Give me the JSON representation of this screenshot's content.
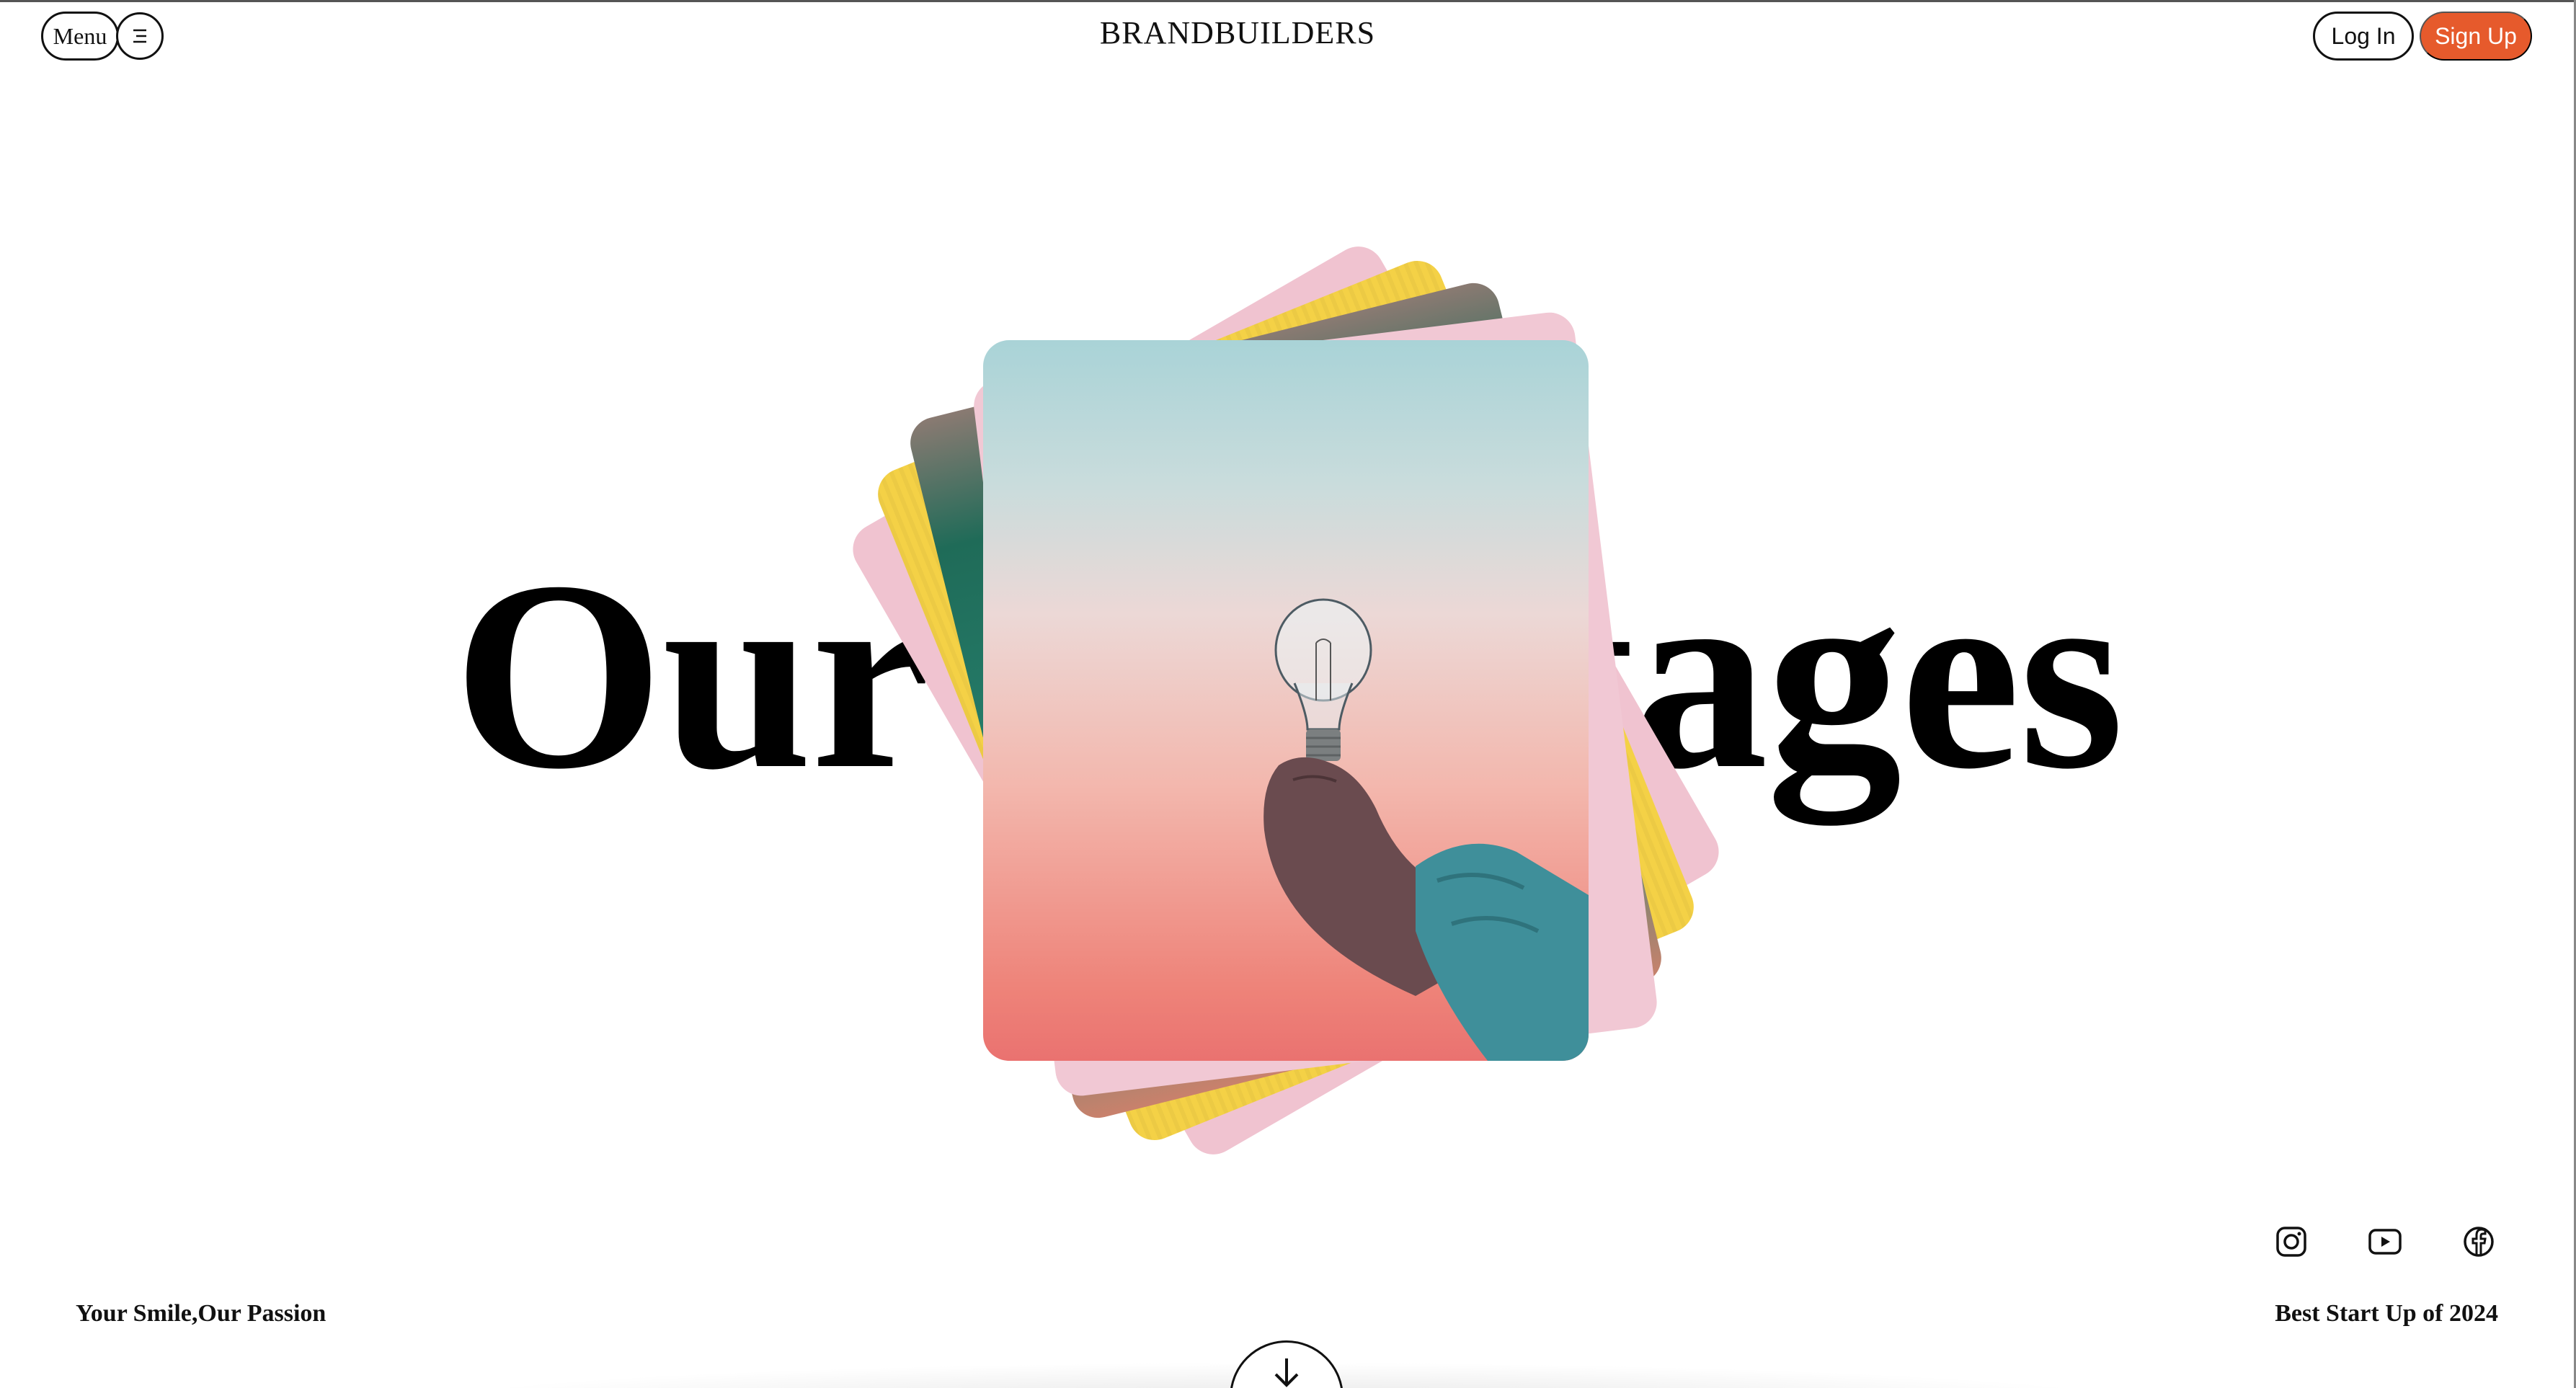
{
  "header": {
    "menu_label": "Menu",
    "brand": "BRANDBUILDERS",
    "login_label": "Log In",
    "signup_label": "Sign Up"
  },
  "hero": {
    "title_part1": "Our A",
    "title_part2": "tages",
    "image_icon": "lightbulb-in-hand"
  },
  "footer": {
    "tagline_left": "Your Smile,Our Passion",
    "tagline_right": "Best Start Up of 2024",
    "social": [
      "instagram-icon",
      "youtube-icon",
      "facebook-icon"
    ]
  },
  "colors": {
    "accent": "#e65a2c",
    "text": "#111111",
    "background": "#ffffff"
  }
}
